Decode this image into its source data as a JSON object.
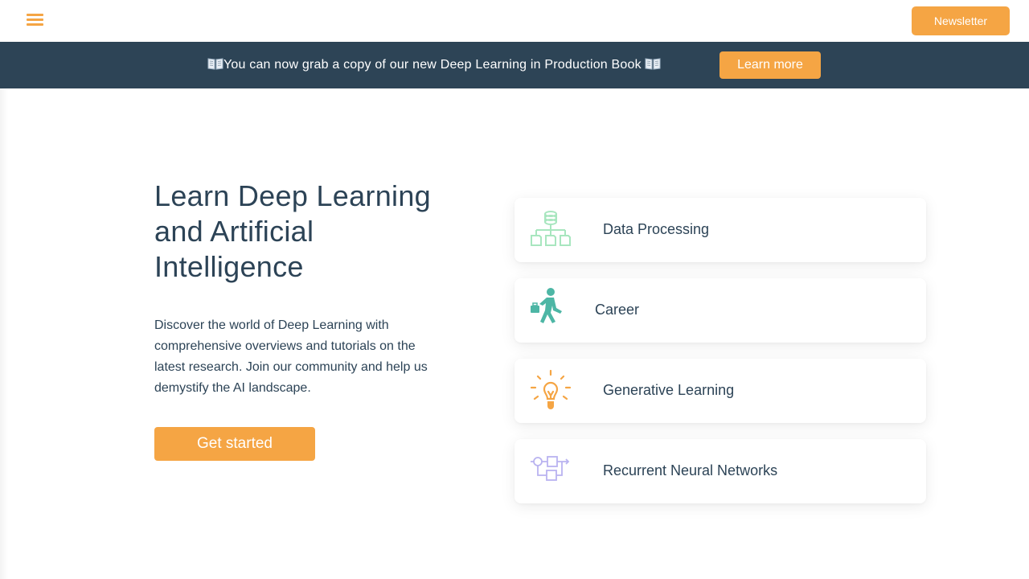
{
  "header": {
    "menu_icon": "hamburger-menu-icon",
    "newsletter_label": "Newsletter"
  },
  "banner": {
    "text": "You can now grab a copy of our new Deep Learning in Production Book",
    "icon": "open-book-icon",
    "learn_more_label": "Learn more"
  },
  "hero": {
    "title_lines": [
      "Learn Deep Learning",
      "and Artificial",
      "Intelligence"
    ],
    "description_lines": [
      "Discover the world of Deep Learning with",
      "comprehensive overviews and tutorials on the",
      "latest research. Join our community and help us",
      "demystify the AI landscape."
    ],
    "cta_label": "Get started"
  },
  "topics": [
    {
      "label": "Data Processing",
      "icon": "data-flow-icon"
    },
    {
      "label": "Career",
      "icon": "walking-businessman-icon"
    },
    {
      "label": "Generative Learning",
      "icon": "lightbulb-icon"
    },
    {
      "label": "Recurrent Neural Networks",
      "icon": "rnn-diagram-icon"
    }
  ],
  "colors": {
    "accent": "#f5a544",
    "banner_bg": "#2d4456",
    "text": "#2c4356",
    "data_icon": "#a8e6bf",
    "career_icon": "#4db6a5",
    "idea_icon": "#f5a544",
    "rnn_icon": "#b9b3f0"
  }
}
